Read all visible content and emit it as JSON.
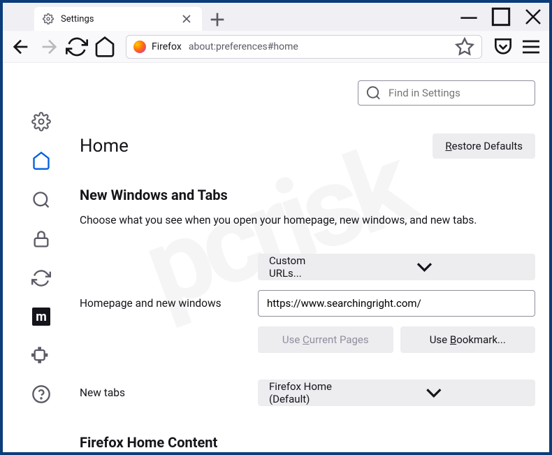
{
  "tab": {
    "title": "Settings"
  },
  "urlbar": {
    "identity": "Firefox",
    "path": "about:preferences#home"
  },
  "search": {
    "placeholder": "Find in Settings"
  },
  "page": {
    "heading": "Home",
    "restore_btn": "Restore Defaults",
    "section1_title": "New Windows and Tabs",
    "section1_desc": "Choose what you see when you open your homepage, new windows, and new tabs.",
    "homepage_label": "Homepage and new windows",
    "homepage_select": "Custom URLs...",
    "homepage_url": "https://www.searchingright.com/",
    "use_current": "Use Current Pages",
    "use_bookmark": "Use Bookmark...",
    "newtabs_label": "New tabs",
    "newtabs_select": "Firefox Home (Default)",
    "section2_title": "Firefox Home Content"
  },
  "watermark": "pcrisk"
}
